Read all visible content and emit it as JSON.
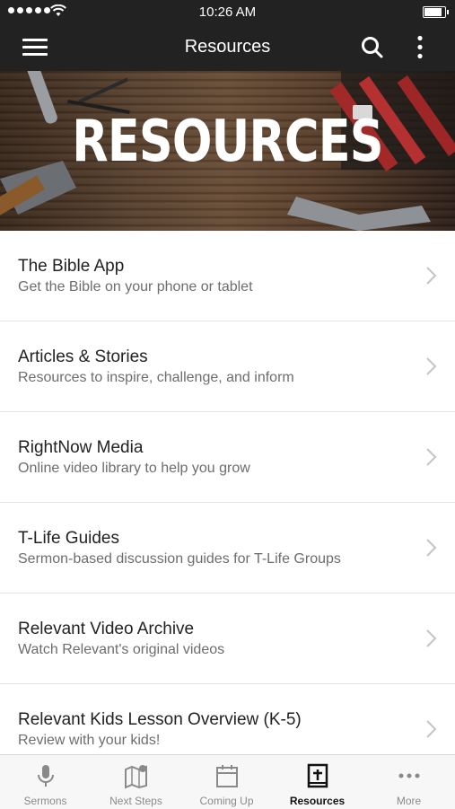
{
  "status_bar": {
    "time": "10:26 AM",
    "signal_dots": 5
  },
  "header": {
    "title": "Resources"
  },
  "banner": {
    "title": "RESOURCES"
  },
  "resources": [
    {
      "title": "The Bible App",
      "subtitle": "Get the Bible on your phone or tablet"
    },
    {
      "title": "Articles & Stories",
      "subtitle": "Resources to inspire, challenge, and inform"
    },
    {
      "title": "RightNow Media",
      "subtitle": "Online video library to help you grow"
    },
    {
      "title": "T-Life Guides",
      "subtitle": "Sermon-based discussion guides for T-Life Groups"
    },
    {
      "title": "Relevant Video Archive",
      "subtitle": "Watch Relevant's original videos"
    },
    {
      "title": "Relevant Kids Lesson Overview (K-5)",
      "subtitle": "Review with your kids!"
    }
  ],
  "tabs": [
    {
      "label": "Sermons",
      "icon": "microphone-icon",
      "active": false
    },
    {
      "label": "Next Steps",
      "icon": "map-pin-icon",
      "active": false
    },
    {
      "label": "Coming Up",
      "icon": "calendar-icon",
      "active": false
    },
    {
      "label": "Resources",
      "icon": "bible-icon",
      "active": true
    },
    {
      "label": "More",
      "icon": "more-dots-icon",
      "active": false
    }
  ],
  "colors": {
    "bar": "#222222",
    "tab_active": "#111111",
    "tab_inactive": "#8a8a8a"
  }
}
